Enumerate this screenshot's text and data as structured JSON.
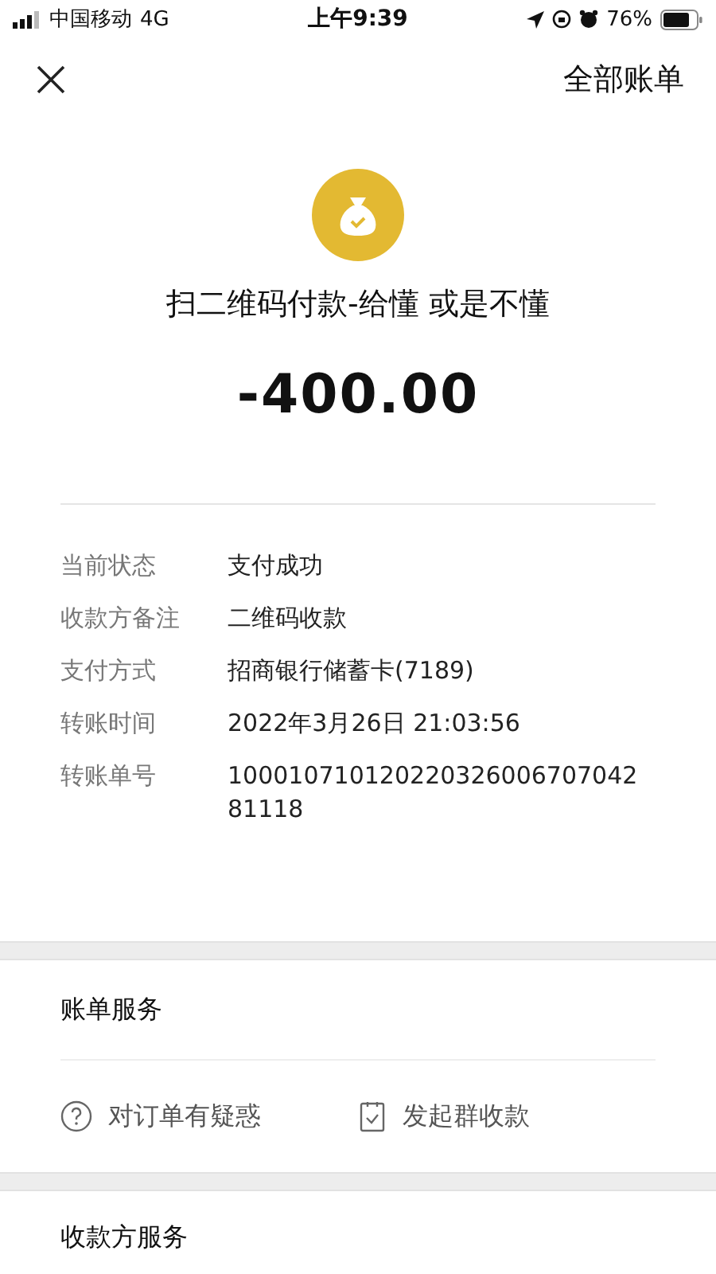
{
  "status_bar": {
    "carrier": "中国移动",
    "network": "4G",
    "time": "上午9:39",
    "battery": "76%"
  },
  "nav": {
    "action": "全部账单"
  },
  "payment": {
    "title": "扫二维码付款-给懂 或是不懂",
    "amount": "-400.00"
  },
  "details": [
    {
      "label": "当前状态",
      "value": "支付成功"
    },
    {
      "label": "收款方备注",
      "value": "二维码收款"
    },
    {
      "label": "支付方式",
      "value": "招商银行储蓄卡(7189)"
    },
    {
      "label": "转账时间",
      "value": "2022年3月26日 21:03:56"
    },
    {
      "label": "转账单号",
      "value": "100010710120220326006707042 81118"
    }
  ],
  "bill_services": {
    "title": "账单服务",
    "actions": [
      {
        "kind": "question",
        "label": "对订单有疑惑"
      },
      {
        "kind": "checklist",
        "label": "发起群收款"
      }
    ]
  },
  "payee_services": {
    "title": "收款方服务"
  }
}
